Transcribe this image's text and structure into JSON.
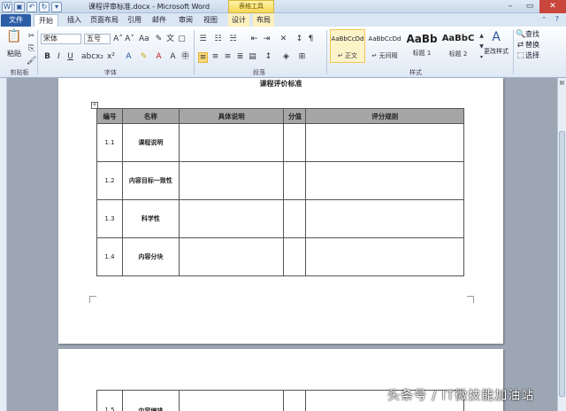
{
  "window": {
    "title": "课程评审标准.docx - Microsoft Word",
    "context_tab_group": "表格工具"
  },
  "tabs": [
    {
      "label": "文件"
    },
    {
      "label": "开始"
    },
    {
      "label": "插入"
    },
    {
      "label": "页面布局"
    },
    {
      "label": "引用"
    },
    {
      "label": "邮件"
    },
    {
      "label": "审阅"
    },
    {
      "label": "视图"
    },
    {
      "label": "设计"
    },
    {
      "label": "布局"
    }
  ],
  "ribbon": {
    "clipboard": {
      "paste_label": "粘贴",
      "group_label": "剪贴板"
    },
    "font": {
      "font_name": "宋体",
      "font_size": "五号",
      "group_label": "字体"
    },
    "paragraph": {
      "group_label": "段落"
    },
    "styles": {
      "group_label": "样式",
      "tiles": [
        {
          "sample": "AaBbCcDd",
          "name": "↵ 正文"
        },
        {
          "sample": "AaBbCcDd",
          "name": "↵ 无间隔"
        },
        {
          "sample": "AaBb",
          "name": "标题 1"
        },
        {
          "sample": "AaBbC",
          "name": "标题 2"
        }
      ],
      "change_styles_label": "更改样式"
    },
    "editing": {
      "find_label": "查找",
      "replace_label": "替换",
      "select_label": "选择",
      "group_label": "编辑"
    }
  },
  "document": {
    "title": "课程评价标准",
    "table_headers": [
      "编号",
      "名称",
      "具体说明",
      "分值",
      "评分规则"
    ],
    "rows": [
      {
        "num": "1.1",
        "name": "课程说明",
        "desc": "",
        "score": "",
        "rule": ""
      },
      {
        "num": "1.2",
        "name": "内容目标一致性",
        "desc": "",
        "score": "",
        "rule": ""
      },
      {
        "num": "1.3",
        "name": "科学性",
        "desc": "",
        "score": "",
        "rule": ""
      },
      {
        "num": "1.4",
        "name": "内容分块",
        "desc": "",
        "score": "",
        "rule": ""
      }
    ],
    "page2_rows": [
      {
        "num": "1.5",
        "name": "内容编排",
        "desc": "",
        "score": "",
        "rule": ""
      }
    ]
  },
  "watermark": "头条号 / IT微技能加油站"
}
